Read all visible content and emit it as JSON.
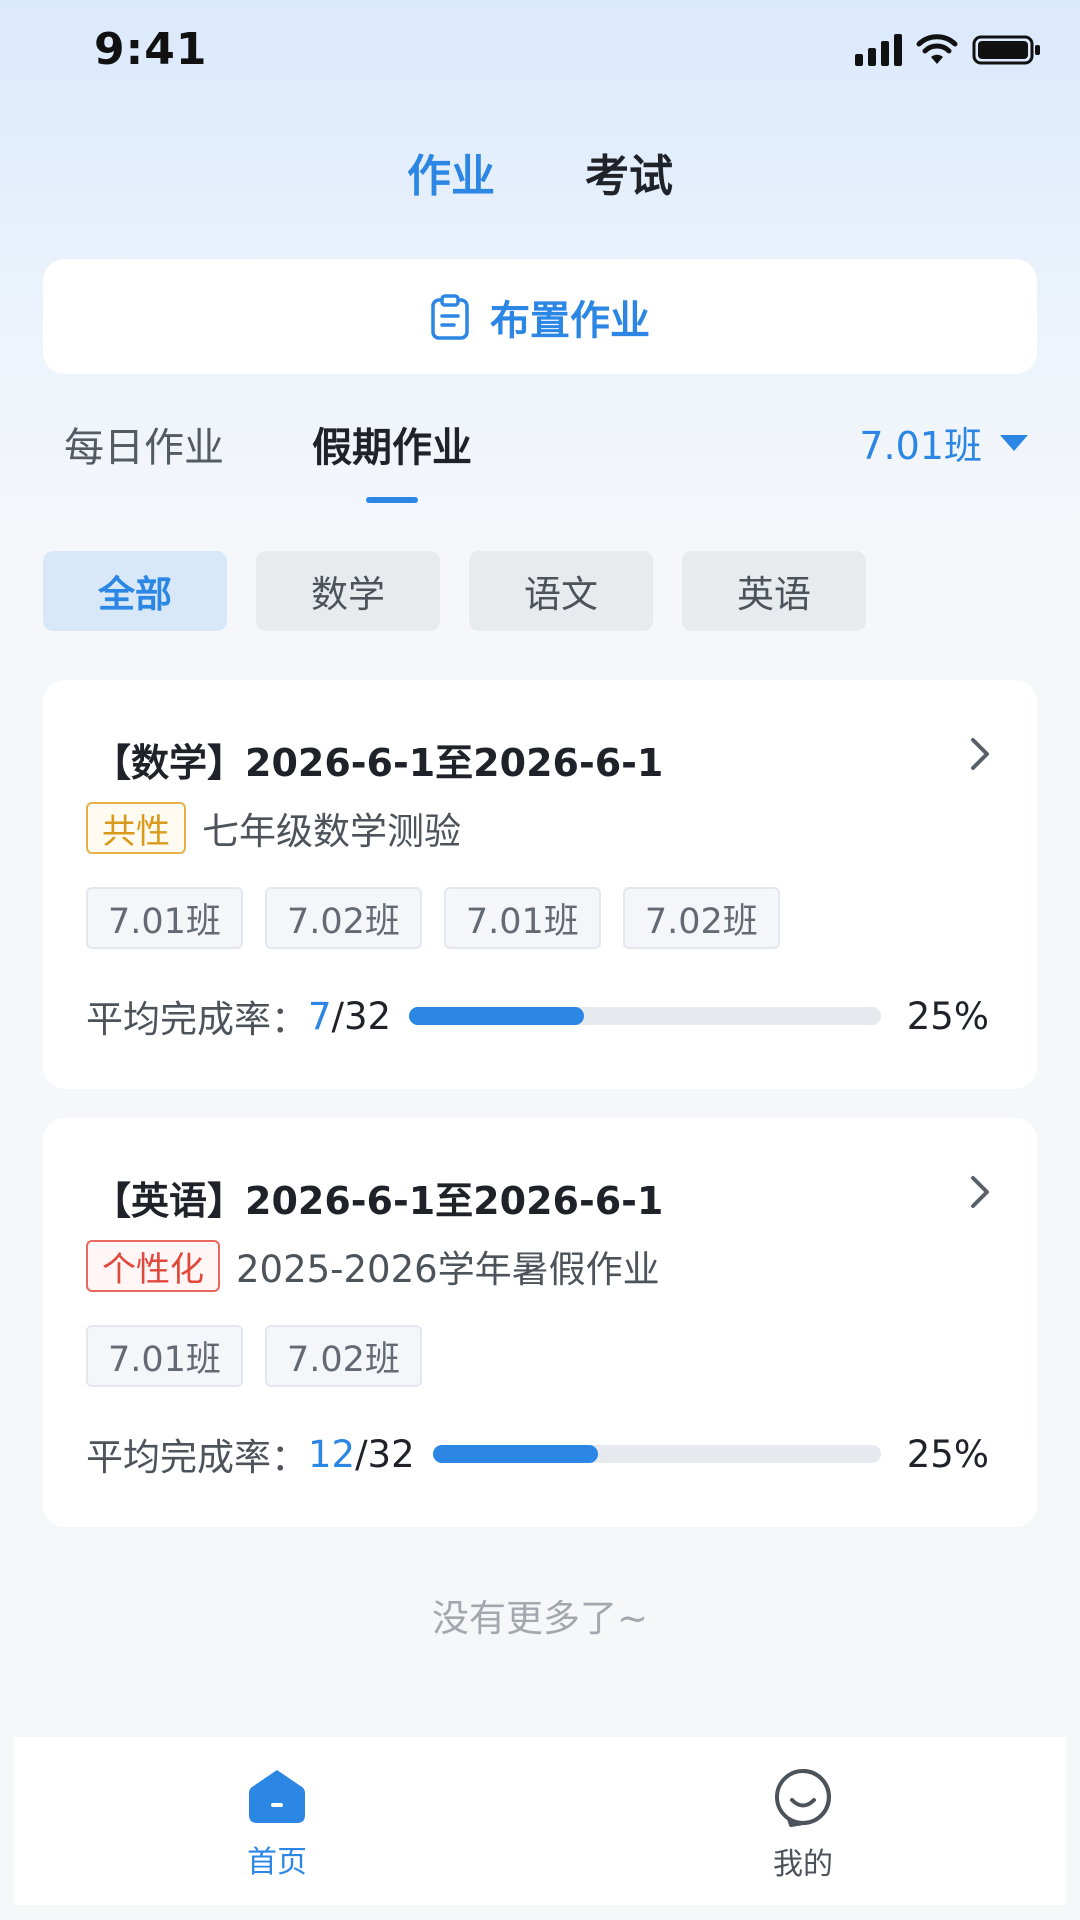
{
  "status_bar": {
    "time": "9:41"
  },
  "top_tabs": [
    {
      "label": "作业",
      "active": true
    },
    {
      "label": "考试",
      "active": false
    }
  ],
  "assign_button": {
    "label": "布置作业",
    "icon": "clipboard-icon"
  },
  "sub_tabs": [
    {
      "label": "每日作业",
      "active": false
    },
    {
      "label": "假期作业",
      "active": true
    }
  ],
  "class_selector": {
    "value": "7.01班",
    "icon": "caret-down-icon"
  },
  "filters": [
    {
      "label": "全部",
      "active": true
    },
    {
      "label": "数学",
      "active": false
    },
    {
      "label": "语文",
      "active": false
    },
    {
      "label": "英语",
      "active": false
    }
  ],
  "cards": [
    {
      "title": "【数学】2026-6-1至2026-6-1",
      "type_tag": "共性",
      "description": "七年级数学测验",
      "classes": [
        "7.01班",
        "7.02班",
        "7.01班",
        "7.02班"
      ],
      "rate_label": "平均完成率：",
      "completed": "7",
      "total": "/32",
      "progress_fraction": 0.37,
      "percent": "25%"
    },
    {
      "title": "【英语】2026-6-1至2026-6-1",
      "type_tag": "个性化",
      "description": "2025-2026学年暑假作业",
      "classes": [
        "7.01班",
        "7.02班"
      ],
      "rate_label": "平均完成率：",
      "completed": "12",
      "total": "/32",
      "progress_fraction": 0.37,
      "percent": "25%"
    }
  ],
  "no_more_text": "没有更多了~",
  "bottom_nav": [
    {
      "label": "首页",
      "icon": "home-icon",
      "active": true
    },
    {
      "label": "我的",
      "icon": "profile-icon",
      "active": false
    }
  ],
  "colors": {
    "accent": "#2b86e4",
    "common_tag": "#d99a1c",
    "personal_tag": "#e0483c"
  }
}
